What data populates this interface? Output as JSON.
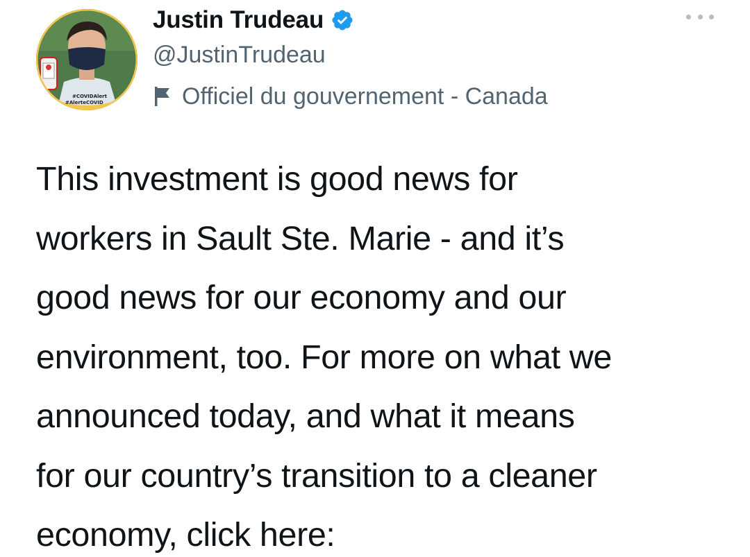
{
  "author": {
    "display_name": "Justin Trudeau",
    "handle": "@JustinTrudeau",
    "verified": true,
    "label": "Officiel du gouvernement - Canada",
    "avatar_badge": [
      "#COVIDAlert",
      "#AlerteCOVID"
    ]
  },
  "tweet": {
    "lines": [
      "This investment is good news for",
      "workers in Sault Ste. Marie - and it’s",
      "good news for our economy and our",
      "environment, too. For more on what we",
      "announced today, and what it means",
      "for our country’s transition to a cleaner",
      "economy, click here:"
    ]
  },
  "icons": {
    "verified": "verified-badge-icon",
    "label": "flag-icon",
    "more": "more-options-icon"
  },
  "colors": {
    "text_primary": "#0f1419",
    "text_secondary": "#536471",
    "verified_blue": "#1d9bf0",
    "badge_yellow": "#f3c54a"
  }
}
